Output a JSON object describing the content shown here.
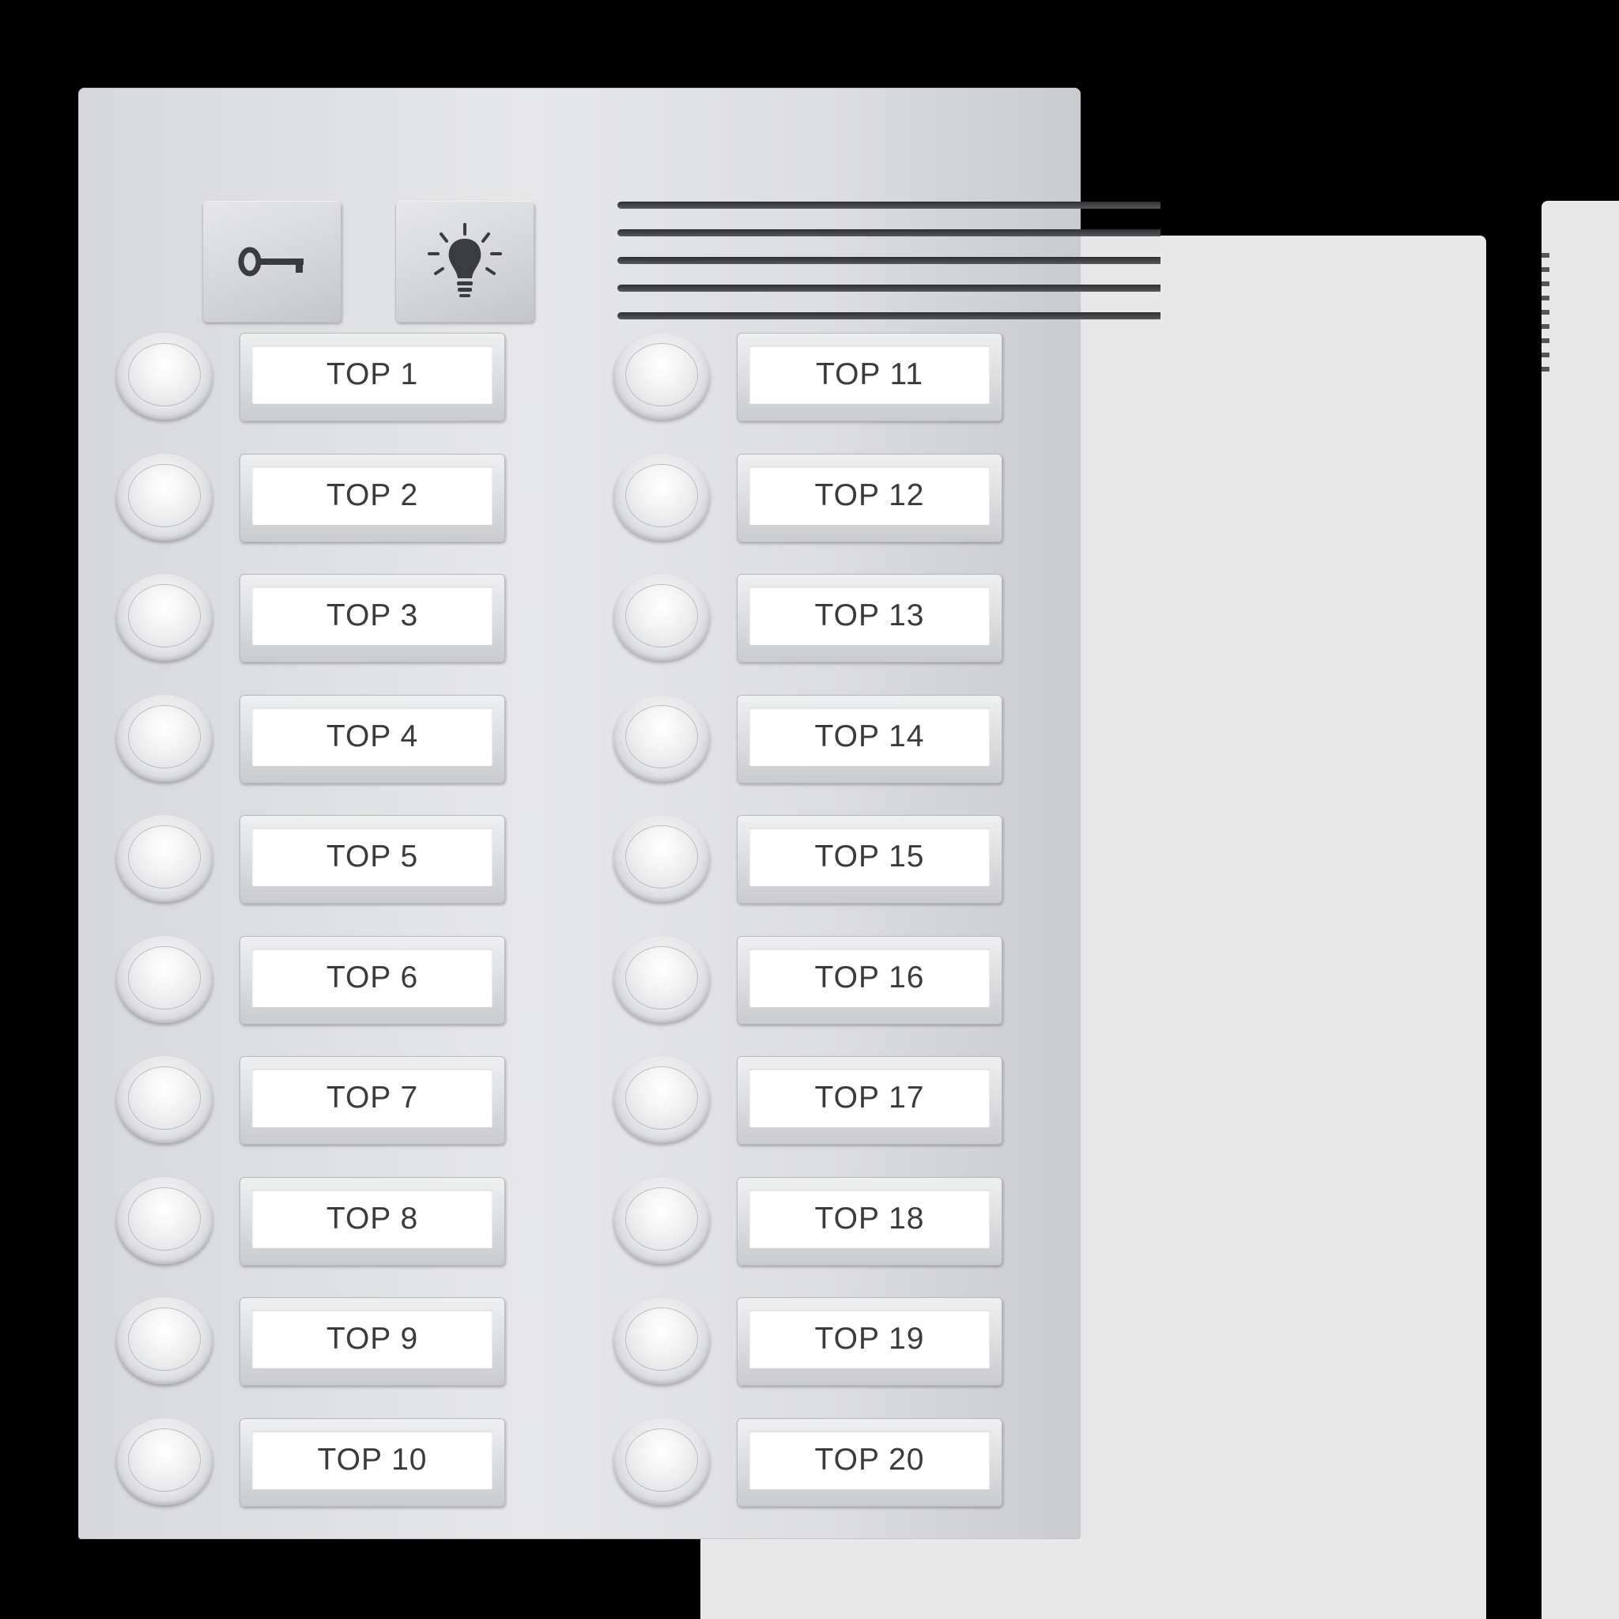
{
  "panel": {
    "key_button_icon": "key-icon",
    "light_button_icon": "lightbulb-icon",
    "speaker_line_count": 5,
    "colors": {
      "panel": "#dcdde0",
      "speaker": "#3a3b3d",
      "label_text": "#3a3b3d",
      "background": "#000000",
      "back_panel": "#e8e8e8"
    }
  },
  "columns": [
    {
      "labels": [
        "TOP 1",
        "TOP 2",
        "TOP 3",
        "TOP 4",
        "TOP 5",
        "TOP 6",
        "TOP 7",
        "TOP 8",
        "TOP 9",
        "TOP 10"
      ]
    },
    {
      "labels": [
        "TOP 11",
        "TOP 12",
        "TOP 13",
        "TOP 14",
        "TOP 15",
        "TOP 16",
        "TOP 17",
        "TOP 18",
        "TOP 19",
        "TOP 20"
      ]
    }
  ]
}
